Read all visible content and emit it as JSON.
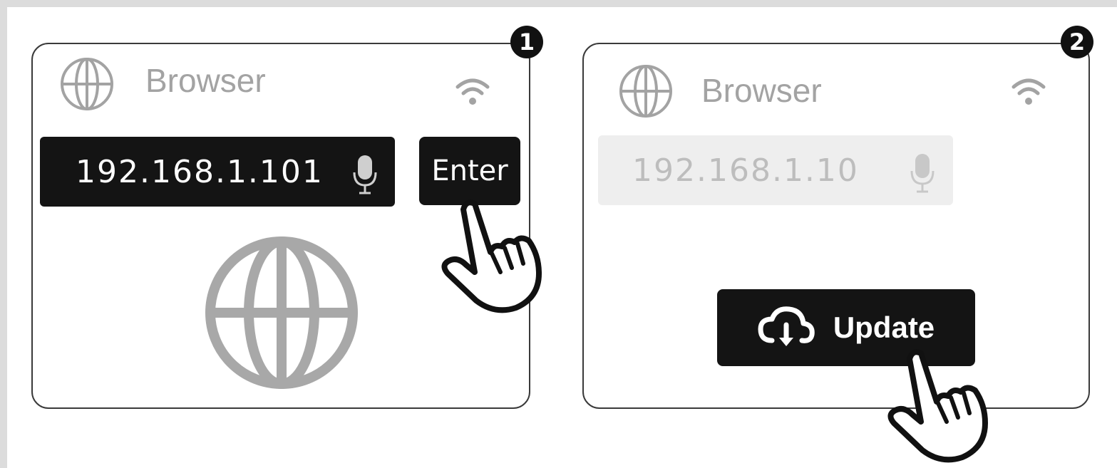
{
  "steps": [
    {
      "number": "1",
      "app_title": "Browser",
      "url_value": "192.168.1.101",
      "button_label": "Enter"
    },
    {
      "number": "2",
      "app_title": "Browser",
      "url_value": "192.168.1.10",
      "button_label": "Update"
    }
  ],
  "icons": {
    "app": "globe-icon",
    "network": "wifi-icon",
    "voice": "microphone-icon",
    "page": "globe-icon",
    "update": "cloud-download-icon",
    "pointer": "hand-pointer-icon"
  },
  "colors": {
    "dark": "#141414",
    "muted_text": "#a3a3a3",
    "disabled_field": "#eeeeee",
    "globe_large": "#a8a8a8"
  }
}
